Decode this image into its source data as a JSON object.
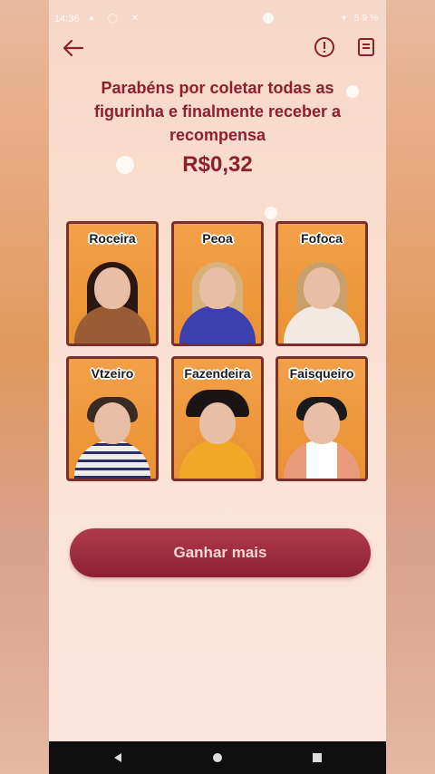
{
  "status_bar": {
    "time": "14:36",
    "battery": "59%"
  },
  "header": {
    "back_icon": "arrow-left-icon",
    "alert_icon": "exclamation-circle-icon",
    "doc_icon": "document-icon"
  },
  "title": "Parabéns por coletar todas as figurinha e finalmente receber a recompensa",
  "amount": "R$0,32",
  "cards": [
    {
      "label": "Roceira"
    },
    {
      "label": "Peoa"
    },
    {
      "label": "Fofoca"
    },
    {
      "label": "Vtzeiro"
    },
    {
      "label": "Fazendeira"
    },
    {
      "label": "Faisqueiro"
    }
  ],
  "cta": {
    "label": "Ganhar mais"
  },
  "colors": {
    "accent": "#8e1f2e",
    "button": "#a3303f",
    "card": "#ee9a3f"
  }
}
